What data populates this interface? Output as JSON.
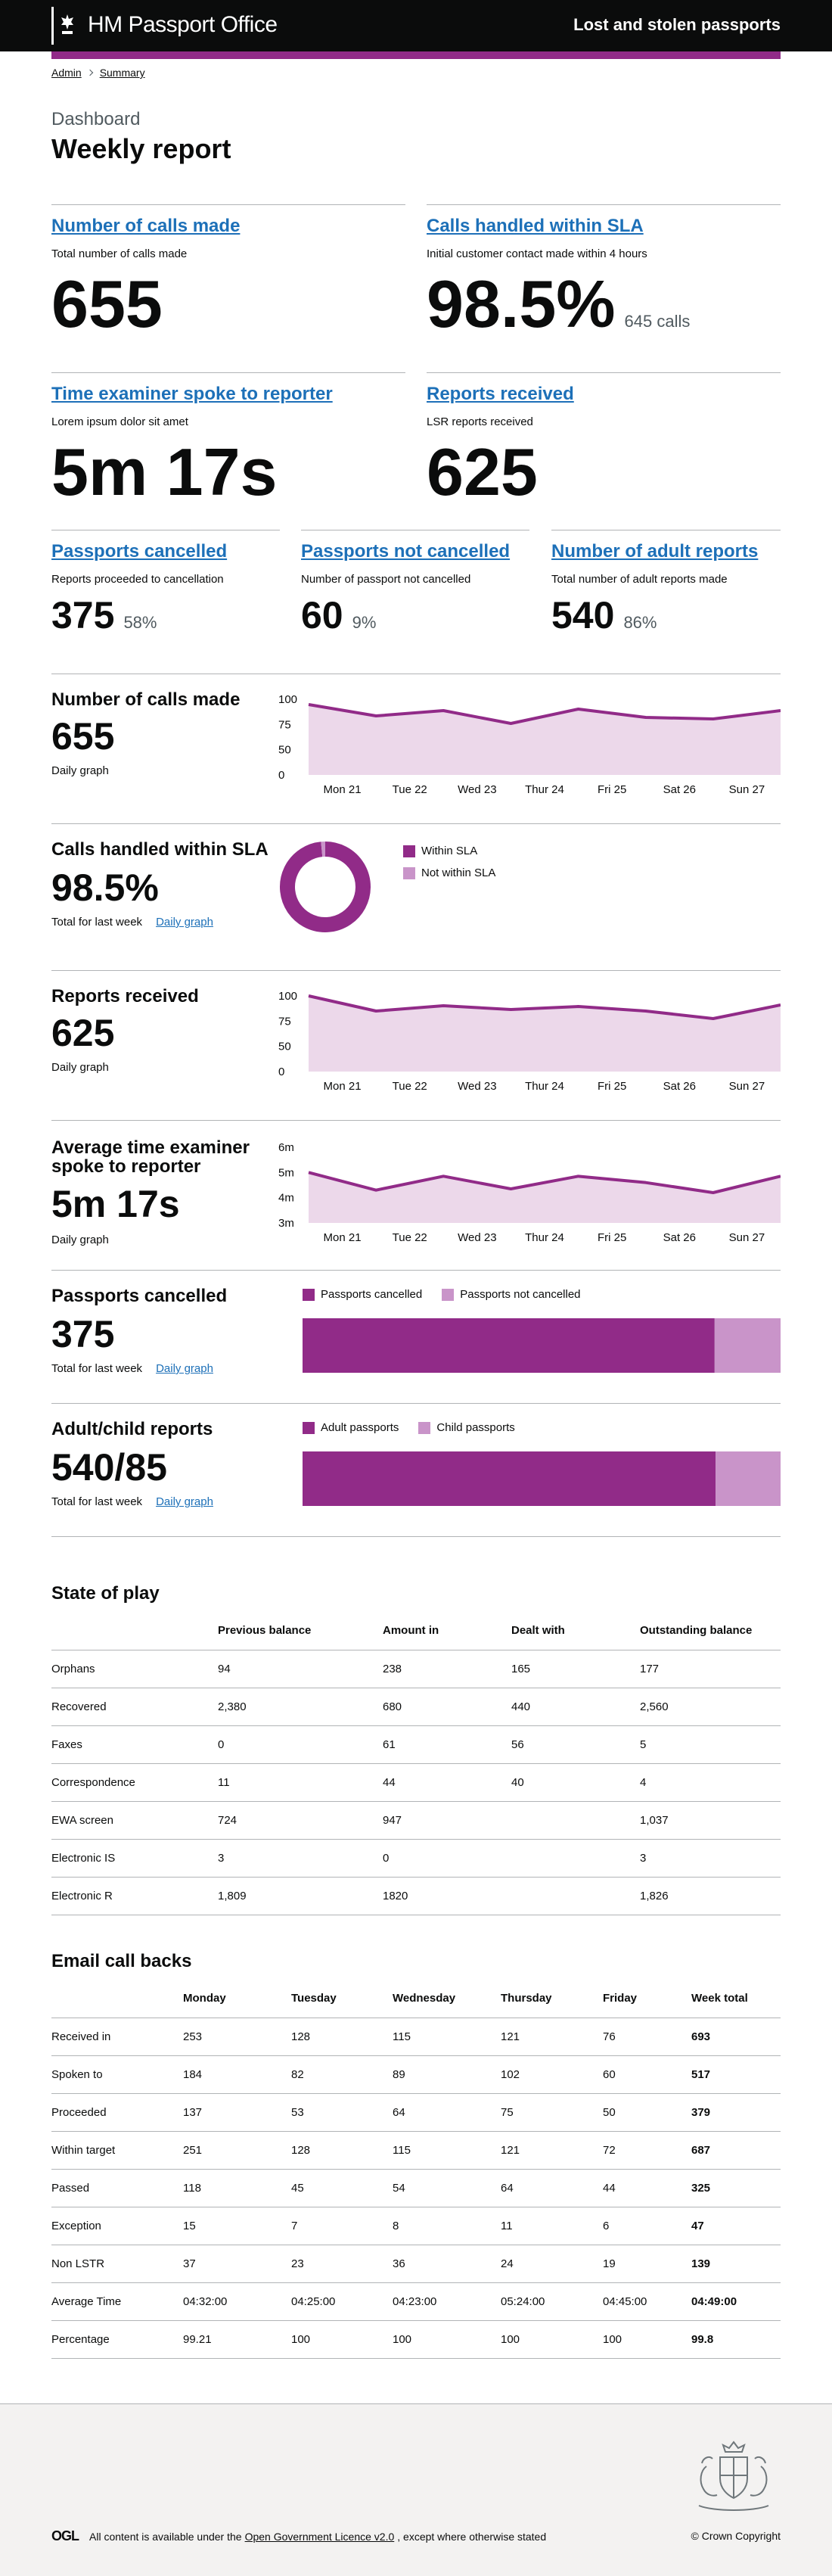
{
  "header": {
    "brand": "HM Passport Office",
    "service": "Lost and stolen passports"
  },
  "breadcrumbs": [
    "Admin",
    "Summary"
  ],
  "page": {
    "caption": "Dashboard",
    "title": "Weekly report"
  },
  "cards": [
    {
      "title": "Number of calls made",
      "desc": "Total number of calls made",
      "value": "655",
      "sub": ""
    },
    {
      "title": "Calls handled within SLA",
      "desc": "Initial customer contact made within 4 hours",
      "value": "98.5%",
      "sub": "645 calls"
    },
    {
      "title": "Time examiner spoke to reporter",
      "desc": "Lorem ipsum dolor sit amet",
      "value": "5m 17s",
      "sub": ""
    },
    {
      "title": "Reports received",
      "desc": "LSR reports received",
      "value": "625",
      "sub": ""
    },
    {
      "title": "Passports cancelled",
      "desc": "Reports proceeded to cancellation",
      "value": "375",
      "sub": "58%"
    },
    {
      "title": "Passports not cancelled",
      "desc": "Number of passport not cancelled",
      "value": "60",
      "sub": "9%"
    },
    {
      "title": "Number of adult reports",
      "desc": "Total number of adult reports made",
      "value": "540",
      "sub": "86%"
    }
  ],
  "graphs": {
    "calls": {
      "title": "Number of calls made",
      "value": "655",
      "note": "Daily graph"
    },
    "sla": {
      "title": "Calls handled within SLA",
      "value": "98.5%",
      "note": "Total for last week",
      "link": "Daily graph"
    },
    "reports": {
      "title": "Reports received",
      "value": "625",
      "note": "Daily graph"
    },
    "time": {
      "title": "Average time examiner spoke to reporter",
      "value": "5m 17s",
      "note": "Daily graph"
    },
    "cancelled": {
      "title": "Passports cancelled",
      "value": "375",
      "note": "Total for last week",
      "link": "Daily graph"
    },
    "adult": {
      "title": "Adult/child reports",
      "value": "540/85",
      "note": "Total for last week",
      "link": "Daily graph"
    }
  },
  "colors": {
    "primary": "#912b88",
    "light": "#c994c9",
    "fill": "#ecd8ea",
    "link": "#1d70b8"
  },
  "chart_data": [
    {
      "type": "area",
      "id": "calls",
      "categories": [
        "Mon 21",
        "Tue 22",
        "Wed 23",
        "Thur 24",
        "Fri 25",
        "Sat 26",
        "Sun 27"
      ],
      "y_ticks": [
        "100",
        "75",
        "50",
        "0"
      ],
      "ylim": [
        0,
        100
      ],
      "values": [
        93,
        78,
        85,
        68,
        87,
        76,
        74,
        85
      ]
    },
    {
      "type": "pie",
      "id": "sla",
      "labels": [
        "Within SLA",
        "Not within SLA"
      ],
      "values": [
        98.5,
        1.5
      ]
    },
    {
      "type": "area",
      "id": "reports",
      "categories": [
        "Mon 21",
        "Tue 22",
        "Wed 23",
        "Thur 24",
        "Fri 25",
        "Sat 26",
        "Sun 27"
      ],
      "y_ticks": [
        "100",
        "75",
        "50",
        "0"
      ],
      "ylim": [
        0,
        100
      ],
      "values": [
        100,
        80,
        87,
        82,
        86,
        80,
        70,
        88
      ]
    },
    {
      "type": "area",
      "id": "time",
      "categories": [
        "Mon 21",
        "Tue 22",
        "Wed 23",
        "Thur 24",
        "Fri 25",
        "Sat 26",
        "Sun 27"
      ],
      "y_ticks": [
        "6m",
        "5m",
        "4m",
        "3m"
      ],
      "ylim": [
        3,
        6
      ],
      "values": [
        5.0,
        4.3,
        4.85,
        4.35,
        4.85,
        4.6,
        4.2,
        4.85
      ]
    },
    {
      "type": "bar",
      "id": "cancelled",
      "labels": [
        "Passports cancelled",
        "Passports not cancelled"
      ],
      "values": [
        375,
        60
      ]
    },
    {
      "type": "bar",
      "id": "adult",
      "labels": [
        "Adult passports",
        "Child passports"
      ],
      "values": [
        540,
        85
      ]
    }
  ],
  "state_of_play": {
    "title": "State of play",
    "headers": [
      "",
      "Previous balance",
      "Amount in",
      "Dealt with",
      "Outstanding balance"
    ],
    "rows": [
      [
        "Orphans",
        "94",
        "238",
        "165",
        "177"
      ],
      [
        "Recovered",
        "2,380",
        "680",
        "440",
        "2,560"
      ],
      [
        "Faxes",
        "0",
        "61",
        "56",
        "5"
      ],
      [
        "Correspondence",
        "11",
        "44",
        "40",
        "4"
      ],
      [
        "EWA screen",
        "724",
        "947",
        "",
        "1,037"
      ],
      [
        "Electronic IS",
        "3",
        "0",
        "",
        "3"
      ],
      [
        "Electronic R",
        "1,809",
        "1820",
        "",
        "1,826"
      ]
    ]
  },
  "email_callbacks": {
    "title": "Email call backs",
    "headers": [
      "",
      "Monday",
      "Tuesday",
      "Wednesday",
      "Thursday",
      "Friday",
      "Week total"
    ],
    "rows": [
      [
        "Received in",
        "253",
        "128",
        "115",
        "121",
        "76",
        "693"
      ],
      [
        "Spoken to",
        "184",
        "82",
        "89",
        "102",
        "60",
        "517"
      ],
      [
        "Proceeded",
        "137",
        "53",
        "64",
        "75",
        "50",
        "379"
      ],
      [
        "Within target",
        "251",
        "128",
        "115",
        "121",
        "72",
        "687"
      ],
      [
        "Passed",
        "118",
        "45",
        "54",
        "64",
        "44",
        "325"
      ],
      [
        "Exception",
        "15",
        "7",
        "8",
        "11",
        "6",
        "47"
      ],
      [
        "Non LSTR",
        "37",
        "23",
        "36",
        "24",
        "19",
        "139"
      ],
      [
        "Average Time",
        "04:32:00",
        "04:25:00",
        "04:23:00",
        "05:24:00",
        "04:45:00",
        "04:49:00"
      ],
      [
        "Percentage",
        "99.21",
        "100",
        "100",
        "100",
        "100",
        "99.8"
      ]
    ]
  },
  "footer": {
    "ogl_logo": "OGL",
    "licence_pre": "All content is available under the",
    "licence_link": "Open Government Licence v2.0",
    "licence_post": ", except where otherwise stated",
    "copyright": "© Crown Copyright"
  }
}
